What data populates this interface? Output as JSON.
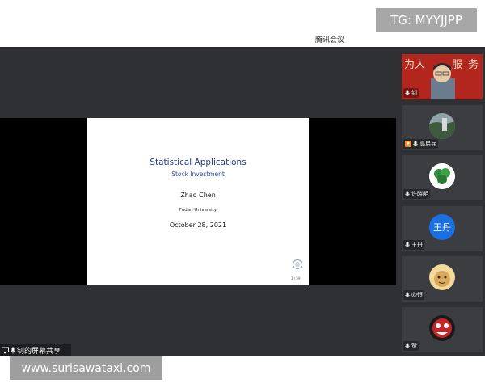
{
  "watermark_top": "TG: MYYJJPP",
  "app_title": "腾讯会议",
  "slide": {
    "title": "Statistical Applications",
    "subtitle": "Stock Investment",
    "author": "Zhao Chen",
    "institution": "Fudan University",
    "date": "October 28, 2021",
    "page": "1 / 59"
  },
  "share_label": "钊的屏幕共享",
  "watermark_bottom": "www.surisawataxi.com",
  "participants": [
    {
      "name": "钊"
    },
    {
      "name": "高启兵"
    },
    {
      "name": "许晓明"
    },
    {
      "name": "王丹",
      "avatar_text": "王丹"
    },
    {
      "name": "@恒"
    },
    {
      "name": "贺"
    }
  ],
  "colors": {
    "stage_bg": "#2e3033",
    "slide_title": "#1f3c8c",
    "avatar_blue": "#1a6fe3"
  }
}
